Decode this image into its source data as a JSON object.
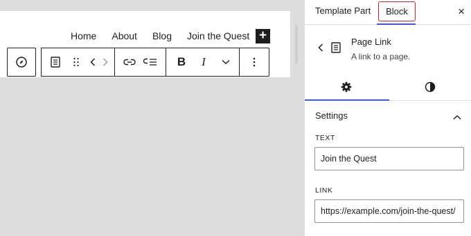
{
  "canvas": {
    "nav_items": [
      "Home",
      "About",
      "Blog",
      "Join the Quest"
    ],
    "add_button": "+"
  },
  "toolbar": {
    "bold": "B",
    "italic": "I"
  },
  "sidebar": {
    "tabs": {
      "template_part": "Template Part",
      "block": "Block"
    },
    "close": "×",
    "block_card": {
      "title": "Page Link",
      "description": "A link to a page."
    },
    "panel": {
      "title": "Settings",
      "text_label": "TEXT",
      "text_value": "Join the Quest",
      "link_label": "LINK",
      "link_value": "https://example.com/join-the-quest/"
    }
  },
  "colors": {
    "accent": "#3858e9",
    "highlight_box": "#e01b1b",
    "canvas_bg": "#dddddd"
  }
}
